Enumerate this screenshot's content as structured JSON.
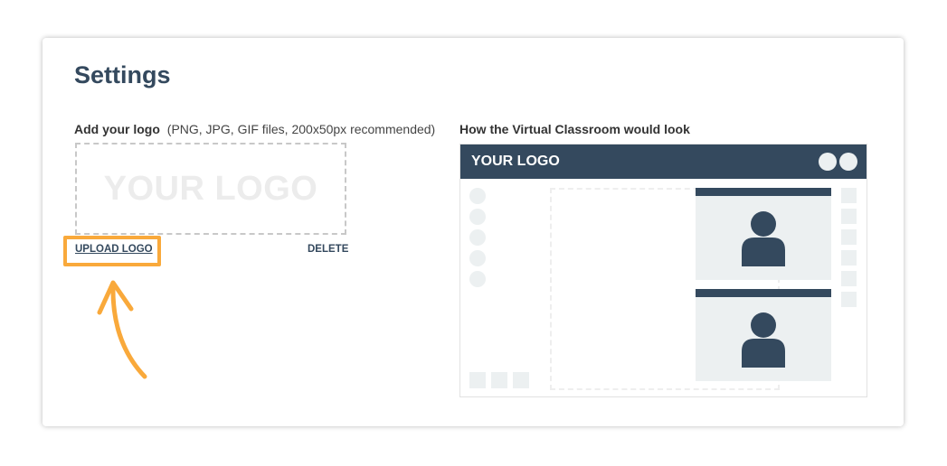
{
  "settings": {
    "title": "Settings"
  },
  "logo_upload": {
    "label": "Add your logo",
    "hint": "(PNG, JPG, GIF files, 200x50px recommended)",
    "placeholder": "YOUR LOGO",
    "upload_label": "UPLOAD LOGO",
    "delete_label": "DELETE"
  },
  "preview": {
    "label": "How the Virtual Classroom would look",
    "header_logo": "YOUR LOGO"
  },
  "colors": {
    "primary": "#34495e",
    "highlight": "#f9a93b",
    "light_gray": "#ecf0f1"
  },
  "icons": [
    "curved-arrow-icon",
    "user-avatar-icon"
  ]
}
